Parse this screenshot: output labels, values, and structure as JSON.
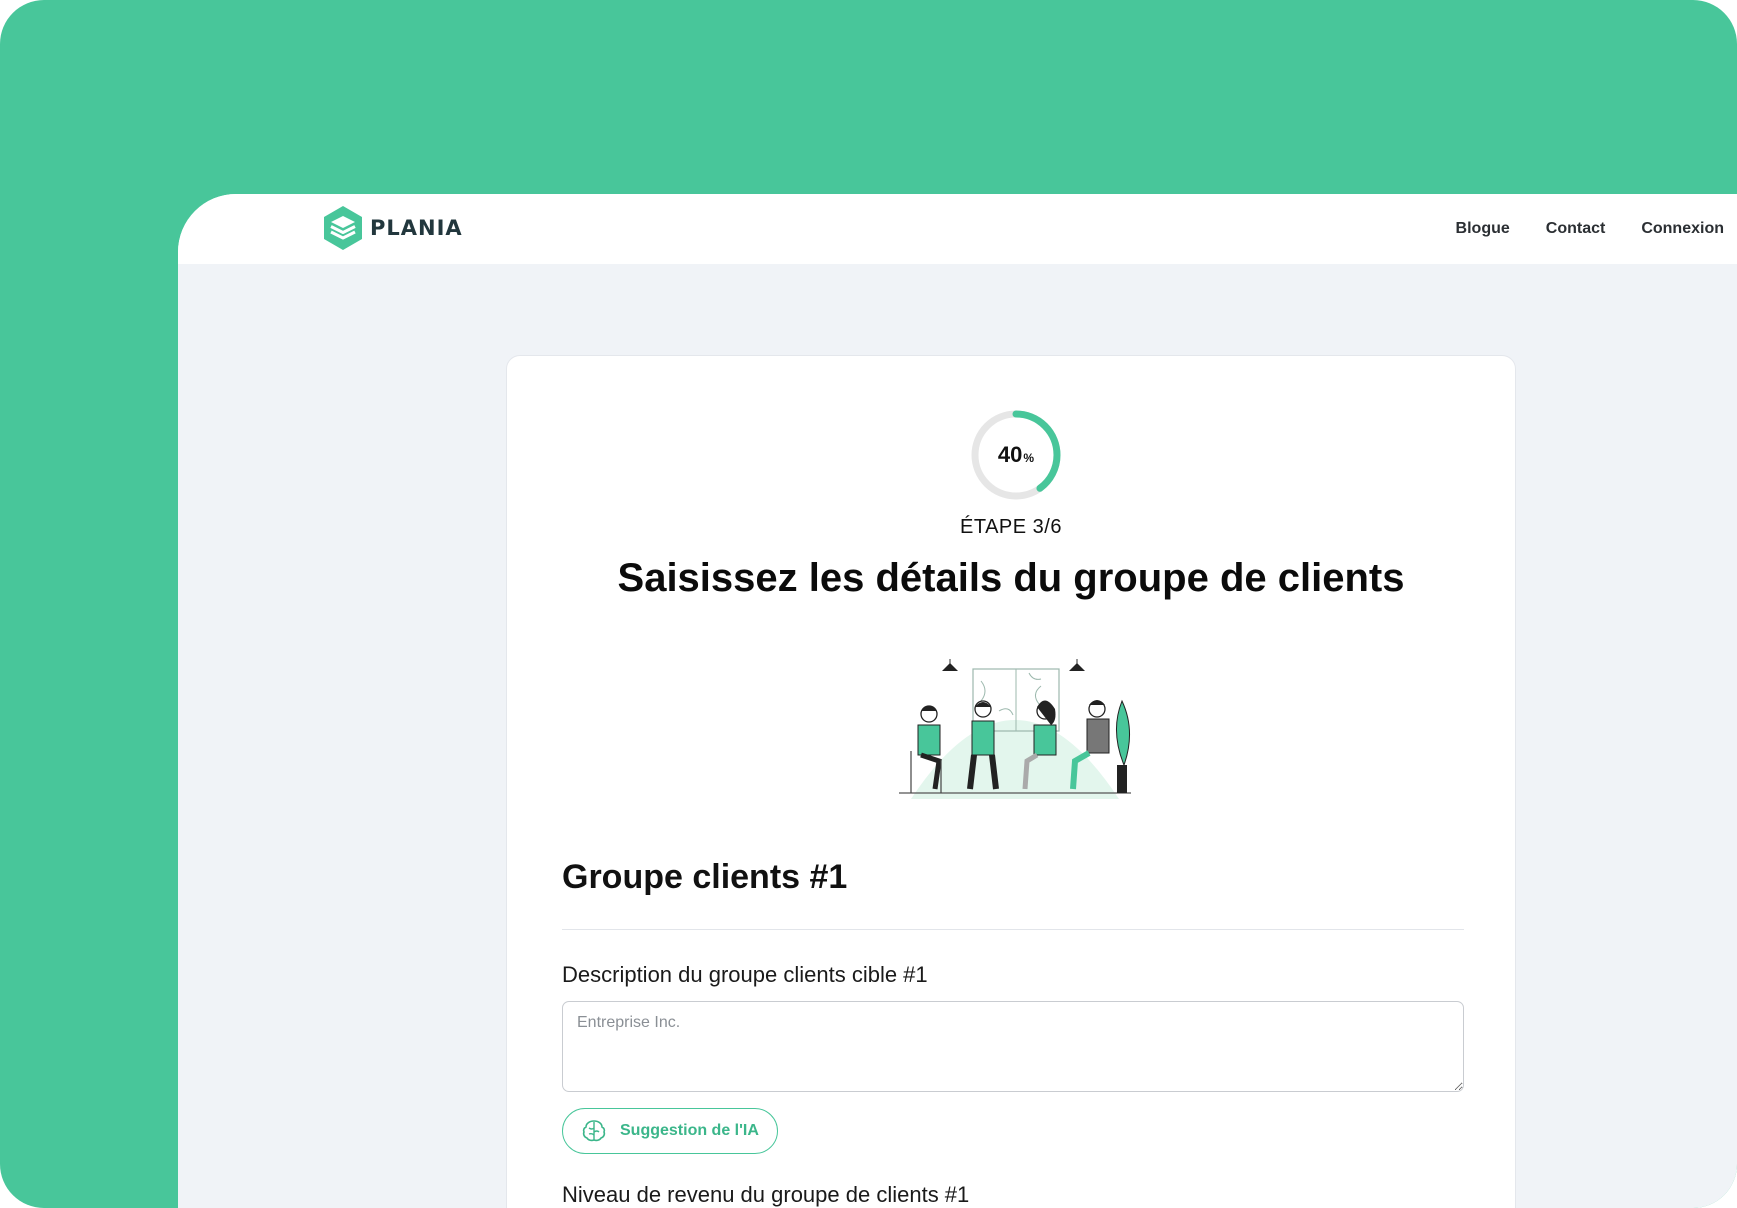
{
  "brand": {
    "name": "PLANIA",
    "accent": "#48c69a",
    "logo_dark": "#22373d"
  },
  "nav": {
    "items": [
      "Blogue",
      "Contact",
      "Connexion"
    ]
  },
  "progress": {
    "value": 40,
    "unit": "%",
    "step": "ÉTAPE 3/6"
  },
  "page": {
    "title": "Saisissez les détails du groupe de clients"
  },
  "group": {
    "title": "Groupe clients #1",
    "description_label": "Description du groupe clients cible #1",
    "description_placeholder": "Entreprise Inc.",
    "ai_button": "Suggestion de l'IA",
    "income_label": "Niveau de revenu du groupe de clients #1"
  },
  "icons": [
    "logo-icon",
    "brain-icon"
  ]
}
